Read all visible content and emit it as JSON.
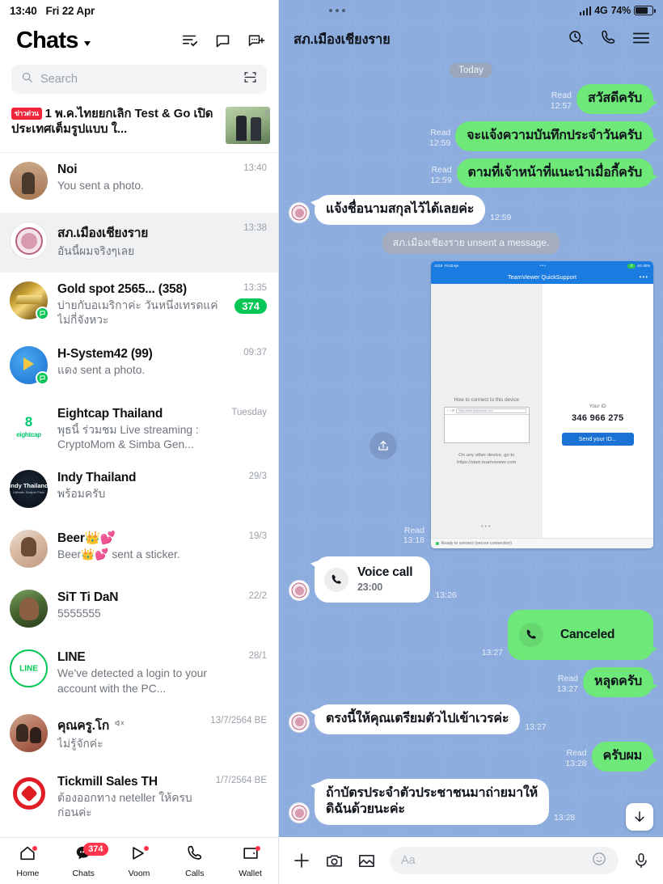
{
  "left": {
    "status": {
      "time": "13:40",
      "date": "Fri 22 Apr"
    },
    "header": {
      "title": "Chats",
      "icons": [
        "read-all-icon",
        "chat-bubble-icon",
        "new-chat-icon"
      ]
    },
    "search": {
      "placeholder": "Search",
      "icon": "search-icon",
      "qr_icon": "qr-scan-icon"
    },
    "news": {
      "badge": "ข่าวด่วน",
      "text": "1 พ.ค.ไทยยกเลิก Test & Go เปิดประเทศเต็มรูปแบบ ใ...",
      "close": "×"
    },
    "chats": [
      {
        "name": "Noi",
        "msg": "You sent a photo.",
        "time": "13:40",
        "badge": "",
        "avatar": "a-noi",
        "selected": false,
        "official": false,
        "muted": false
      },
      {
        "name": "สภ.เมืองเชียงราย",
        "msg": "อันนี้ผมจริงๆเลย",
        "time": "13:38",
        "badge": "",
        "avatar": "a-police",
        "selected": true,
        "official": false,
        "muted": false
      },
      {
        "name": "Gold spot 2565... (358)",
        "msg": "บ่ายกับอเมริกาค่ะ วันหนึ่งเทรดแค่ไม่กี่จังหวะ",
        "time": "13:35",
        "badge": "374",
        "avatar": "a-gold",
        "selected": false,
        "official": true,
        "muted": false
      },
      {
        "name": "H-System42 (99)",
        "msg": "แดง sent a photo.",
        "time": "09:37",
        "badge": "",
        "avatar": "a-hsys",
        "selected": false,
        "official": true,
        "muted": false
      },
      {
        "name": "Eightcap Thailand",
        "msg": "พุธนี้ ร่วมชม Live streaming : CryptoMom & Simba Gen...",
        "time": "Tuesday",
        "badge": "",
        "avatar": "a-eight",
        "selected": false,
        "official": false,
        "muted": false
      },
      {
        "name": "Indy Thailand",
        "msg": "พร้อมครับ",
        "time": "29/3",
        "badge": "",
        "avatar": "a-indy",
        "selected": false,
        "official": false,
        "muted": false
      },
      {
        "name": "Beer👑💕",
        "msg": "Beer👑💕 sent a sticker.",
        "time": "19/3",
        "badge": "",
        "avatar": "a-beer",
        "selected": false,
        "official": false,
        "muted": false
      },
      {
        "name": "SiT Ti DaN",
        "msg": "5555555",
        "time": "22/2",
        "badge": "",
        "avatar": "a-sit",
        "selected": false,
        "official": false,
        "muted": false
      },
      {
        "name": "LINE",
        "msg": "We've detected a login to your account with the PC...",
        "time": "28/1",
        "badge": "",
        "avatar": "a-line",
        "selected": false,
        "official": false,
        "muted": false
      },
      {
        "name": "คุณครู.โก",
        "msg": "ไม่รู้จักค่ะ",
        "time": "13/7/2564 BE",
        "badge": "",
        "avatar": "a-kru",
        "selected": false,
        "official": false,
        "muted": true
      },
      {
        "name": "Tickmill Sales TH",
        "msg": "ต้องออกทาง neteller ให้ครบก่อนค่ะ",
        "time": "1/7/2564 BE",
        "badge": "",
        "avatar": "a-tick",
        "selected": false,
        "official": false,
        "muted": false
      }
    ],
    "nav": [
      {
        "label": "Home",
        "icon": "home-icon",
        "dot": true,
        "badge": ""
      },
      {
        "label": "Chats",
        "icon": "chats-icon",
        "dot": false,
        "badge": "374"
      },
      {
        "label": "Voom",
        "icon": "voom-icon",
        "dot": true,
        "badge": ""
      },
      {
        "label": "Calls",
        "icon": "calls-icon",
        "dot": false,
        "badge": ""
      },
      {
        "label": "Wallet",
        "icon": "wallet-icon",
        "dot": true,
        "badge": ""
      }
    ]
  },
  "right": {
    "status": {
      "network": "4G",
      "battery": "74%"
    },
    "header": {
      "title": "สภ.เมืองเชียงราย",
      "icons": [
        "search-history-icon",
        "phone-icon",
        "menu-icon"
      ]
    },
    "day_divider": "Today",
    "system_notice": "สภ.เมืองเชียงราย unsent a message.",
    "messages": [
      {
        "kind": "text",
        "side": "out",
        "text": "สวัสดีครับ",
        "read": "Read",
        "time": "12:57"
      },
      {
        "kind": "text",
        "side": "out",
        "text": "จะแจ้งความบันทึกประจำวันครับ",
        "read": "Read",
        "time": "12:59"
      },
      {
        "kind": "text",
        "side": "out",
        "text": "ตามที่เจ้าหน้าที่แนะนำเมื่อกี้ครับ",
        "read": "Read",
        "time": "12:59"
      },
      {
        "kind": "text",
        "side": "in",
        "text": "แจ้งชื่อนามสกุลไว้ได้เลยค่ะ",
        "read": "",
        "time": "12:59"
      },
      {
        "kind": "image",
        "side": "out",
        "read": "Read",
        "time": "13:18"
      },
      {
        "kind": "call",
        "side": "in",
        "title": "Voice call",
        "duration": "23:00",
        "time": "13:26"
      },
      {
        "kind": "call",
        "side": "out",
        "title": "Canceled",
        "duration": "",
        "time": "13:27"
      },
      {
        "kind": "text",
        "side": "out",
        "text": "หลุดครับ",
        "read": "Read",
        "time": "13:27"
      },
      {
        "kind": "text",
        "side": "in",
        "text": "ตรงนี้ให้คุณเตรียมตัวไปเข้าเวรค่ะ",
        "read": "",
        "time": "13:27"
      },
      {
        "kind": "text",
        "side": "out",
        "text": "ครับผม",
        "read": "Read",
        "time": "13:28"
      },
      {
        "kind": "text",
        "side": "in",
        "text": "ถ้าบัตรประจำตัวประชาชนมาถ่ายมาให้ดิฉันด้วยนะค่ะ",
        "read": "",
        "time": "13:28"
      }
    ],
    "shared_screenshot": {
      "status_time": "13:18",
      "status_date": "Fri 22 Apr",
      "status_network": "4G 40%",
      "app_title": "TeamViewer QuickSupport",
      "left_heading": "How to connect to this device",
      "left_url": "https://start.teamviewer.com",
      "left_note": "On any other device, go to\nhttps://start.teamviewer.com",
      "right_label": "Your ID",
      "right_id": "346 966 275",
      "right_button": "Send your ID...",
      "footer": "Ready to connect (secure connection)"
    },
    "scroll_down_icon": "arrow-down-icon",
    "input": {
      "placeholder": "Aa",
      "icons": [
        "plus-icon",
        "camera-icon",
        "gallery-icon",
        "emoji-icon",
        "mic-icon"
      ]
    }
  }
}
